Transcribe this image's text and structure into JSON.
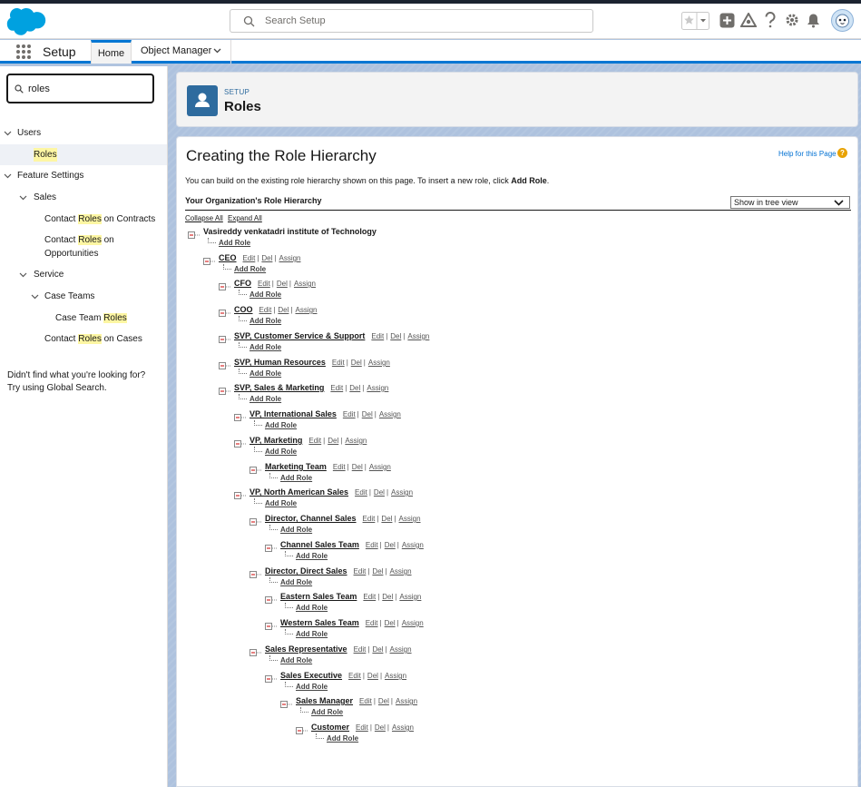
{
  "header": {
    "search_placeholder": "Search Setup"
  },
  "nav": {
    "app_title": "Setup",
    "tabs": [
      {
        "label": "Home"
      },
      {
        "label": "Object Manager"
      }
    ]
  },
  "sidebar": {
    "quickfind_value": "roles",
    "tree": {
      "users": "Users",
      "roles": "Roles",
      "feature_settings": "Feature Settings",
      "sales": "Sales",
      "contact_roles_contracts_pre": "Contact ",
      "contact_roles_contracts_hl": "Roles",
      "contact_roles_contracts_post": " on Contracts",
      "contact_roles_opps_pre": "Contact ",
      "contact_roles_opps_hl": "Roles",
      "contact_roles_opps_post": " on",
      "contact_roles_opps_line2": "Opportunities",
      "service": "Service",
      "case_teams": "Case Teams",
      "case_team_roles_pre": "Case Team ",
      "case_team_roles_hl": "Roles",
      "contact_roles_cases_pre": "Contact ",
      "contact_roles_cases_hl": "Roles",
      "contact_roles_cases_post": " on Cases"
    },
    "not_found_line1": "Didn't find what you're looking for?",
    "not_found_line2": "Try using Global Search."
  },
  "page_header": {
    "eyebrow": "SETUP",
    "title": "Roles"
  },
  "content": {
    "heading": "Creating the Role Hierarchy",
    "help_link": "Help for this Page",
    "intro_text": "You can build on the existing role hierarchy shown on this page. To insert a new role, click ",
    "intro_bold": "Add Role",
    "intro_end": ".",
    "org_hierarchy_label": "Your Organization's Role Hierarchy",
    "view_select_value": "Show in tree view",
    "collapse_all": "Collapse All",
    "expand_all": "Expand All",
    "root": "Vasireddy venkatadri institute of Technology",
    "add_role": "Add Role",
    "edit": "Edit",
    "del": "Del",
    "assign": "Assign",
    "sep": "|",
    "roles": [
      {
        "name": "CEO"
      },
      {
        "name": "CFO"
      },
      {
        "name": "COO"
      },
      {
        "name": "SVP, Customer Service & Support"
      },
      {
        "name": "SVP, Human Resources"
      },
      {
        "name": "SVP, Sales & Marketing"
      },
      {
        "name": "VP, International Sales"
      },
      {
        "name": "VP, Marketing"
      },
      {
        "name": "Marketing Team"
      },
      {
        "name": "VP, North American Sales"
      },
      {
        "name": "Director, Channel Sales"
      },
      {
        "name": "Channel Sales Team"
      },
      {
        "name": "Director, Direct Sales"
      },
      {
        "name": "Eastern Sales Team"
      },
      {
        "name": "Western Sales Team"
      },
      {
        "name": "Sales Representative"
      },
      {
        "name": "Sales Executive"
      },
      {
        "name": "Sales Manager"
      },
      {
        "name": "Customer"
      }
    ]
  },
  "colors": {
    "brand_blue": "#0176d3",
    "header_icon": "#2e6b9e",
    "highlight": "#fdf6a3",
    "band": "#aec2de"
  }
}
